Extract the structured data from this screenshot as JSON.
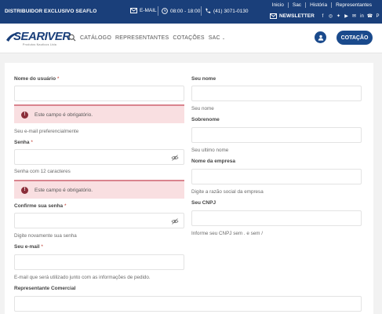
{
  "topbar": {
    "distributor": "DISTRIBUIDOR EXCLUSIVO SEAFLO",
    "email": "E-MAIL",
    "hours": "08:00 - 18:00",
    "phone": "(41) 3071-0130",
    "links": [
      "Inicio",
      "Sac",
      "História",
      "Representantes"
    ],
    "newsletter": "NEWSLETTER",
    "social_icons": [
      "facebook-icon",
      "instagram-icon",
      "twitter-icon",
      "youtube-icon",
      "email-icon",
      "linkedin-icon",
      "phone-icon",
      "pinterest-icon",
      "whatsapp-icon"
    ]
  },
  "nav": {
    "logo_text": "SEARIVER",
    "logo_tagline": "Produtos Nauticos Ltda",
    "items": [
      "CATÁLOGO",
      "REPRESENTANTES",
      "COTAÇÕES",
      "SAC"
    ],
    "quote_button": "COTAÇÃO"
  },
  "form": {
    "username_label": "Nome do usuário",
    "required_mark": "*",
    "error_text": "Este campo é obrigatório.",
    "email_pref_hint": "Seu e-mail preferencialmente",
    "password_label": "Senha",
    "password_hint": "Senha com 12 caracteres",
    "confirm_label": "Confirme sua senha",
    "confirm_hint": "Digite novamente sua senha",
    "email_label": "Seu e-mail",
    "email_hint": "E-mail que será utilizado junto com as informações de pedido.",
    "rep_label": "Representante Comercial",
    "name_label": "Seu nome",
    "name_hint": "Seu nome",
    "surname_label": "Sobrenome",
    "surname_hint": "Seu ultimo nome",
    "company_label": "Nome da empresa",
    "company_hint": "Digite a razão social da empresa",
    "cnpj_label": "Seu CNPJ",
    "cnpj_hint": "Informe seu CNPJ sem . e sem /"
  },
  "colors": {
    "brand_blue": "#1a3f7a",
    "button_blue": "#1a4a8c",
    "error_bg": "#f9dfe1",
    "error_border": "#d9848e"
  }
}
